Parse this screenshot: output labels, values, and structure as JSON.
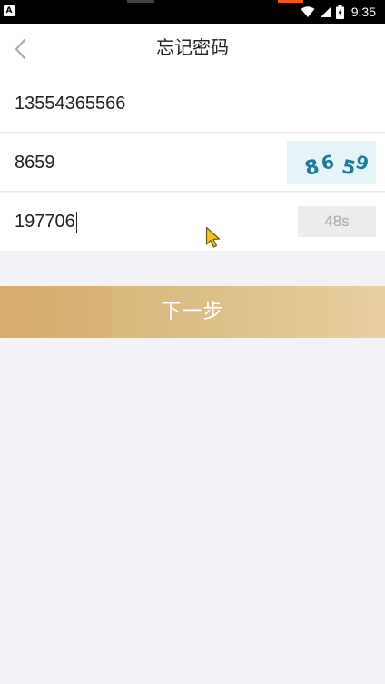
{
  "status_bar": {
    "left_icon": "A",
    "time": "9:35",
    "icons": [
      "wifi-icon",
      "signal-icon",
      "battery-icon"
    ]
  },
  "header": {
    "title": "忘记密码",
    "back_icon": "chevron-left-icon"
  },
  "form": {
    "phone_value": "13554365566",
    "captcha_value": "8659",
    "captcha_image_text": "8659",
    "sms_code_value": "197706",
    "countdown_label": "48s"
  },
  "next_button": {
    "label": "下一步"
  },
  "colors": {
    "page_background": "#f2f1f6",
    "button_gradient_start": "#d4ac6b",
    "button_gradient_end": "#e8cf9f",
    "captcha_digit_color": "#1f7a95",
    "captcha_background": "#e4f4f8"
  }
}
